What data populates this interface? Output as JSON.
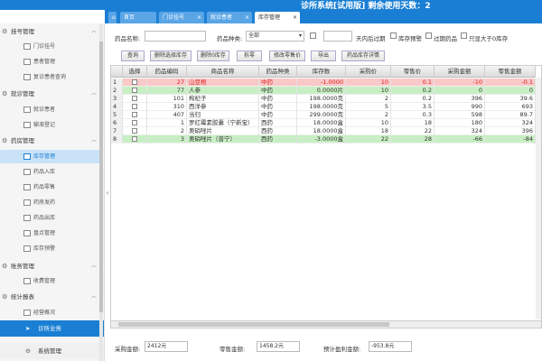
{
  "app": {
    "title": "诊所系统[试用版]  剩余使用天数：2"
  },
  "tabs": [
    {
      "label": "首页"
    },
    {
      "label": "门诊挂号"
    },
    {
      "label": "就诊患者"
    },
    {
      "label": "库存管理"
    }
  ],
  "sidebar": {
    "groups": [
      {
        "label": "挂号管理",
        "items": [
          "门诊挂号",
          "患者管理",
          "复诊患者查询"
        ]
      },
      {
        "label": "就诊管理",
        "items": [
          "就诊患者",
          "输液登记"
        ]
      },
      {
        "label": "药房管理",
        "items": [
          "库存管理",
          "药品入库",
          "药品零售",
          "药房发药",
          "药品出库",
          "盘点管理",
          "库存预警"
        ]
      },
      {
        "label": "账务管理",
        "items": [
          "收费管理"
        ]
      },
      {
        "label": "统计报表",
        "items": [
          "经营概况"
        ]
      }
    ],
    "bottom_buttons": [
      "诊所业务",
      "系统管理"
    ]
  },
  "filter": {
    "name_label": "药品名称:",
    "name_value": "",
    "type_label": "药品种类:",
    "type_value": "全部",
    "days_suffix": "天内后过期",
    "chk_stock_warning": "库存预警",
    "chk_expired": "过期药品",
    "chk_gt_zero": "只显大于0库存"
  },
  "toolbar": {
    "buttons": [
      "查询",
      "删除选择库存",
      "删除0库存",
      "拆零",
      "修改零售价",
      "导出",
      "药品库存详情"
    ]
  },
  "table": {
    "columns": [
      "选择",
      "药品编码",
      "商品名称",
      "药品种类",
      "库存数",
      "采购价",
      "零售价",
      "采购金额",
      "零售金额"
    ],
    "rows": [
      {
        "no": "1",
        "code": "27",
        "name": "山豆根",
        "type": "中药",
        "stock": "-1.0000",
        "buy": "10",
        "sell": "0.1",
        "buy_amt": "-10",
        "sell_amt": "-0.1",
        "style": "red"
      },
      {
        "no": "2",
        "code": "77",
        "name": "人参",
        "type": "中药",
        "stock": "0.0000片",
        "buy": "10",
        "sell": "0.2",
        "buy_amt": "0",
        "sell_amt": "0",
        "style": "green"
      },
      {
        "no": "3",
        "code": "101",
        "name": "枸杞子",
        "type": "中药",
        "stock": "198.0000克",
        "buy": "2",
        "sell": "0.2",
        "buy_amt": "396",
        "sell_amt": "39.6",
        "style": "white"
      },
      {
        "no": "4",
        "code": "310",
        "name": "西洋参",
        "type": "中药",
        "stock": "198.0000克",
        "buy": "5",
        "sell": "3.5",
        "buy_amt": "990",
        "sell_amt": "693",
        "style": "white"
      },
      {
        "no": "5",
        "code": "407",
        "name": "当归",
        "type": "中药",
        "stock": "299.0000克",
        "buy": "2",
        "sell": "0.3",
        "buy_amt": "598",
        "sell_amt": "89.7",
        "style": "white"
      },
      {
        "no": "6",
        "code": "1",
        "name": "罗红霉素胶囊（宁新宝）",
        "type": "西药",
        "stock": "18.0000盒",
        "buy": "10",
        "sell": "18",
        "buy_amt": "180",
        "sell_amt": "324",
        "style": "white"
      },
      {
        "no": "7",
        "code": "2",
        "name": "奥硝唑片",
        "type": "西药",
        "stock": "18.0000盒",
        "buy": "18",
        "sell": "22",
        "buy_amt": "324",
        "sell_amt": "396",
        "style": "white"
      },
      {
        "no": "8",
        "code": "3",
        "name": "奥硝唑片（普宁）",
        "type": "西药",
        "stock": "-3.0000盒",
        "buy": "22",
        "sell": "28",
        "buy_amt": "-66",
        "sell_amt": "-84",
        "style": "green"
      }
    ]
  },
  "footer": {
    "buy_total_label": "采购金额:",
    "buy_total": "2412元",
    "sell_total_label": "零售金额:",
    "sell_total": "1458.2元",
    "profit_label": "预计盈利金额:",
    "profit": "-953.8元"
  },
  "colors": {
    "primary": "#1a7fd4",
    "row_red": "#f9c8c8",
    "row_green": "#c8efc4",
    "text_red": "#e02020"
  }
}
